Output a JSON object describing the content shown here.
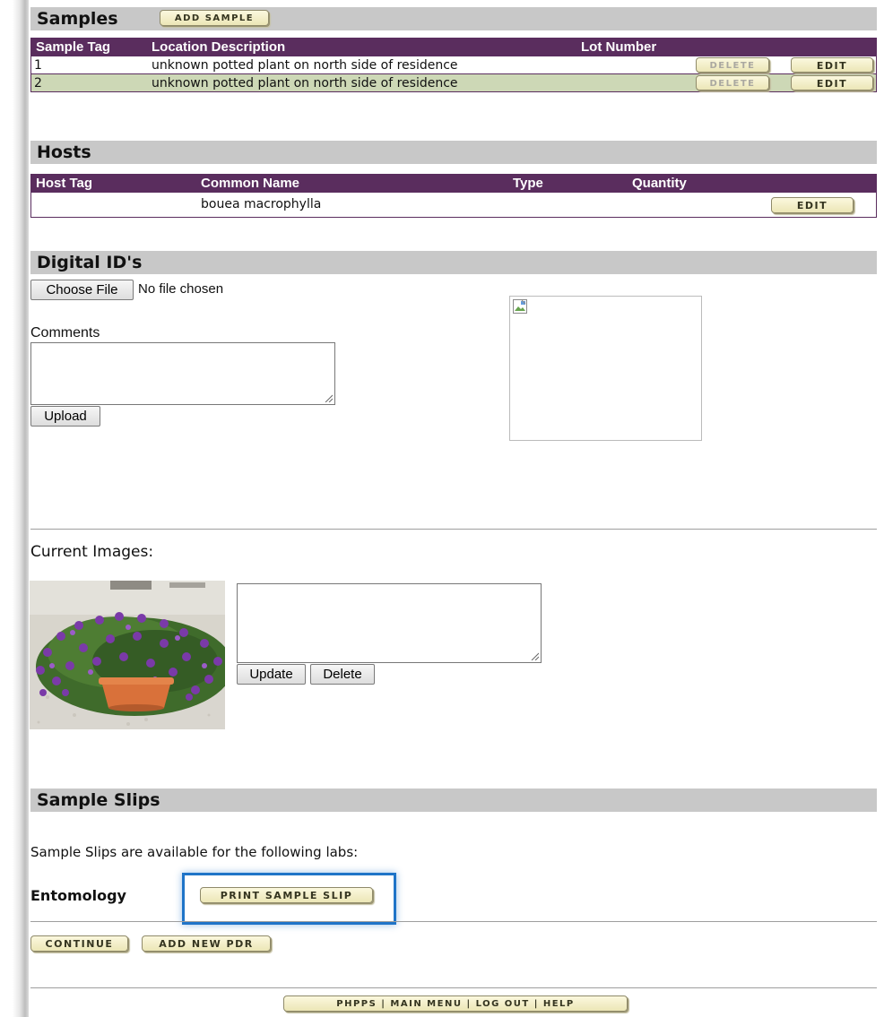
{
  "samples": {
    "title": "Samples",
    "add_label": "ADD SAMPLE",
    "columns": [
      "Sample Tag",
      "Location Description",
      "Lot Number"
    ],
    "rows": [
      {
        "tag": "1",
        "location": "unknown potted plant on north side of residence",
        "lot": "",
        "delete_label": "DELETE",
        "edit_label": "EDIT"
      },
      {
        "tag": "2",
        "location": "unknown potted plant on north side of residence",
        "lot": "",
        "delete_label": "DELETE",
        "edit_label": "EDIT"
      }
    ]
  },
  "hosts": {
    "title": "Hosts",
    "columns": [
      "Host Tag",
      "Common Name",
      "Type",
      "Quantity"
    ],
    "rows": [
      {
        "tag": "",
        "common_name": "bouea macrophylla",
        "type": "",
        "quantity": "",
        "edit_label": "EDIT"
      }
    ]
  },
  "digital_ids": {
    "title": "Digital ID's",
    "choose_file_label": "Choose File",
    "no_file_text": "No file chosen",
    "comments_label": "Comments",
    "comments_value": "",
    "upload_label": "Upload",
    "current_images_label": "Current Images:",
    "image_comment_value": "",
    "update_label": "Update",
    "delete_label": "Delete"
  },
  "sample_slips": {
    "title": "Sample Slips",
    "description": "Sample Slips are available for the following labs:",
    "labs": [
      {
        "name": "Entomology",
        "print_label": "PRINT SAMPLE SLIP"
      }
    ]
  },
  "actions": {
    "continue_label": "CONTINUE",
    "add_pdr_label": "ADD NEW PDR"
  },
  "footer": {
    "nav_label": "PHPPS | MAIN MENU | LOG OUT | HELP"
  },
  "colors": {
    "header_bar": "#c8c8c8",
    "table_header": "#5a2d5e",
    "alt_row": "#cdd8b6",
    "highlight_box": "#1f74c8"
  }
}
